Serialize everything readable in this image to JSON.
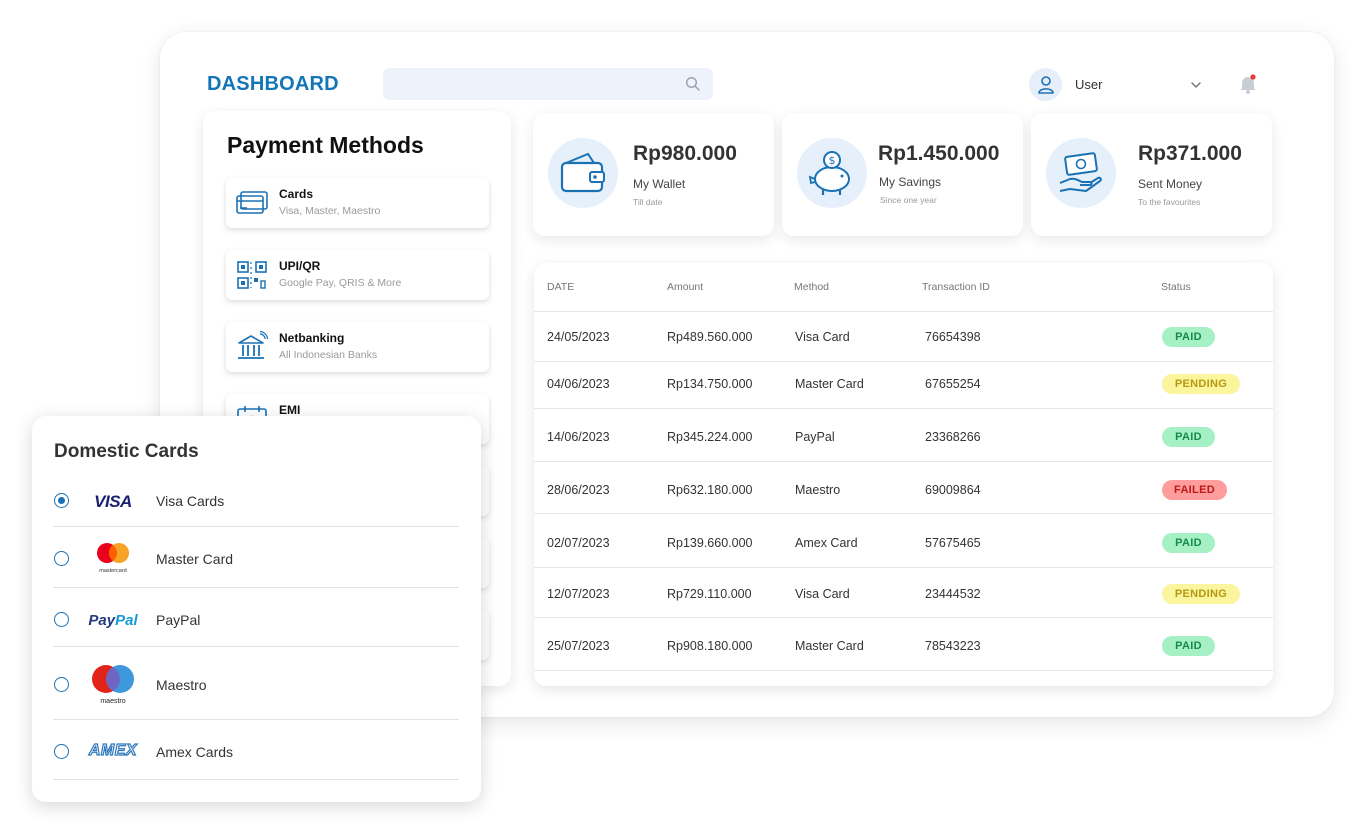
{
  "header": {
    "title": "DASHBOARD",
    "user": "User"
  },
  "payment_methods": {
    "title": "Payment Methods",
    "items": [
      {
        "name": "Cards",
        "sub": "Visa, Master, Maestro"
      },
      {
        "name": "UPI/QR",
        "sub": "Google Pay, QRIS & More"
      },
      {
        "name": "Netbanking",
        "sub": "All Indonesian Banks"
      },
      {
        "name": "EMI",
        "sub": ""
      }
    ]
  },
  "stats": [
    {
      "value": "Rp980.000",
      "label": "My Wallet",
      "sub": "Till date",
      "icon": "wallet-icon"
    },
    {
      "value": "Rp1.450.000",
      "label": "My Savings",
      "sub": "Since one year",
      "icon": "piggy-bank-icon"
    },
    {
      "value": "Rp371.000",
      "label": "Sent Money",
      "sub": "To the favourites",
      "icon": "send-money-icon"
    }
  ],
  "transactions": {
    "columns": [
      "DATE",
      "Amount",
      "Method",
      "Transaction ID",
      "Status"
    ],
    "rows": [
      {
        "date": "24/05/2023",
        "amount": "Rp489.560.000",
        "method": "Visa Card",
        "id": "76654398",
        "status": "PAID"
      },
      {
        "date": "04/06/2023",
        "amount": "Rp134.750.000",
        "method": "Master Card",
        "id": "67655254",
        "status": "PENDING"
      },
      {
        "date": "14/06/2023",
        "amount": "Rp345.224.000",
        "method": "PayPal",
        "id": "23368266",
        "status": "PAID"
      },
      {
        "date": "28/06/2023",
        "amount": "Rp632.180.000",
        "method": "Maestro",
        "id": "69009864",
        "status": "FAILED"
      },
      {
        "date": "02/07/2023",
        "amount": "Rp139.660.000",
        "method": "Amex Card",
        "id": "57675465",
        "status": "PAID"
      },
      {
        "date": "12/07/2023",
        "amount": "Rp729.110.000",
        "method": "Visa Card",
        "id": "23444532",
        "status": "PENDING"
      },
      {
        "date": "25/07/2023",
        "amount": "Rp908.180.000",
        "method": "Master Card",
        "id": "78543223",
        "status": "PAID"
      }
    ]
  },
  "domestic_cards": {
    "title": "Domestic Cards",
    "options": [
      {
        "label": "Visa Cards",
        "logo_text": "VISA",
        "selected": true
      },
      {
        "label": "Master Card",
        "logo_text": "mastercard",
        "selected": false
      },
      {
        "label": "PayPal",
        "logo_text": "PayPal",
        "selected": false
      },
      {
        "label": "Maestro",
        "logo_text": "maestro",
        "selected": false
      },
      {
        "label": "Amex Cards",
        "logo_text": "AMEX",
        "selected": false
      }
    ]
  },
  "colors": {
    "brand": "#1476b8",
    "paid_bg": "#a6f0c6",
    "pending_bg": "#fbf59e",
    "failed_bg": "#ff9c9c"
  }
}
